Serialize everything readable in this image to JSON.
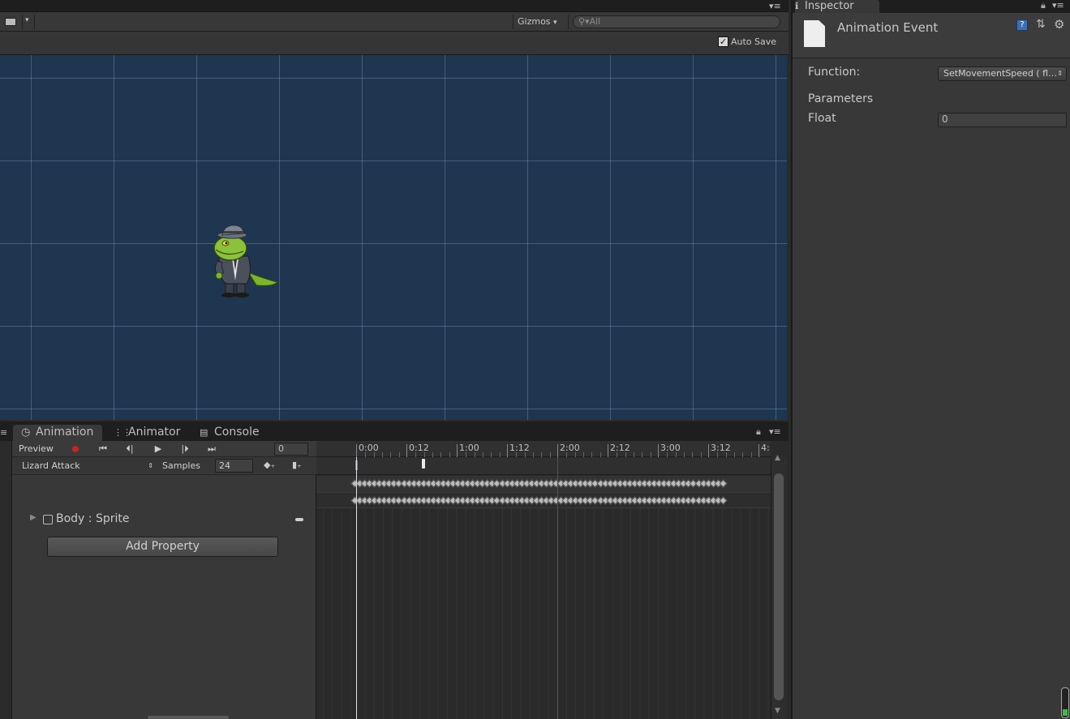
{
  "scene": {
    "gizmos_label": "Gizmos",
    "search_placeholder": "All",
    "auto_save_label": "Auto Save",
    "auto_save_checked": true,
    "grid_color": "#1f3650",
    "character_name": "Lizard sprite"
  },
  "inspector": {
    "tab_label": "Inspector",
    "title": "Animation Event",
    "function_label": "Function:",
    "function_value": "SetMovementSpeed ( fl…",
    "parameters_label": "Parameters",
    "float_label": "Float",
    "float_value": "0"
  },
  "animation": {
    "tabs": [
      {
        "label": "Animation",
        "icon": "clock-icon",
        "active": true
      },
      {
        "label": "Animator",
        "icon": "animator-icon",
        "active": false
      },
      {
        "label": "Console",
        "icon": "console-icon",
        "active": false
      }
    ],
    "preview_label": "Preview",
    "frame_value": "0",
    "clip_name": "Lizard Attack",
    "samples_label": "Samples",
    "samples_value": "24",
    "property_label": "Body : Sprite",
    "add_property_label": "Add Property",
    "timeline_ticks": [
      "0:00",
      "0:12",
      "1:00",
      "1:12",
      "2:00",
      "2:12",
      "3:00",
      "3:12",
      "4:"
    ],
    "record_color": "#cc2222",
    "playhead_color": "#4a90e2"
  }
}
